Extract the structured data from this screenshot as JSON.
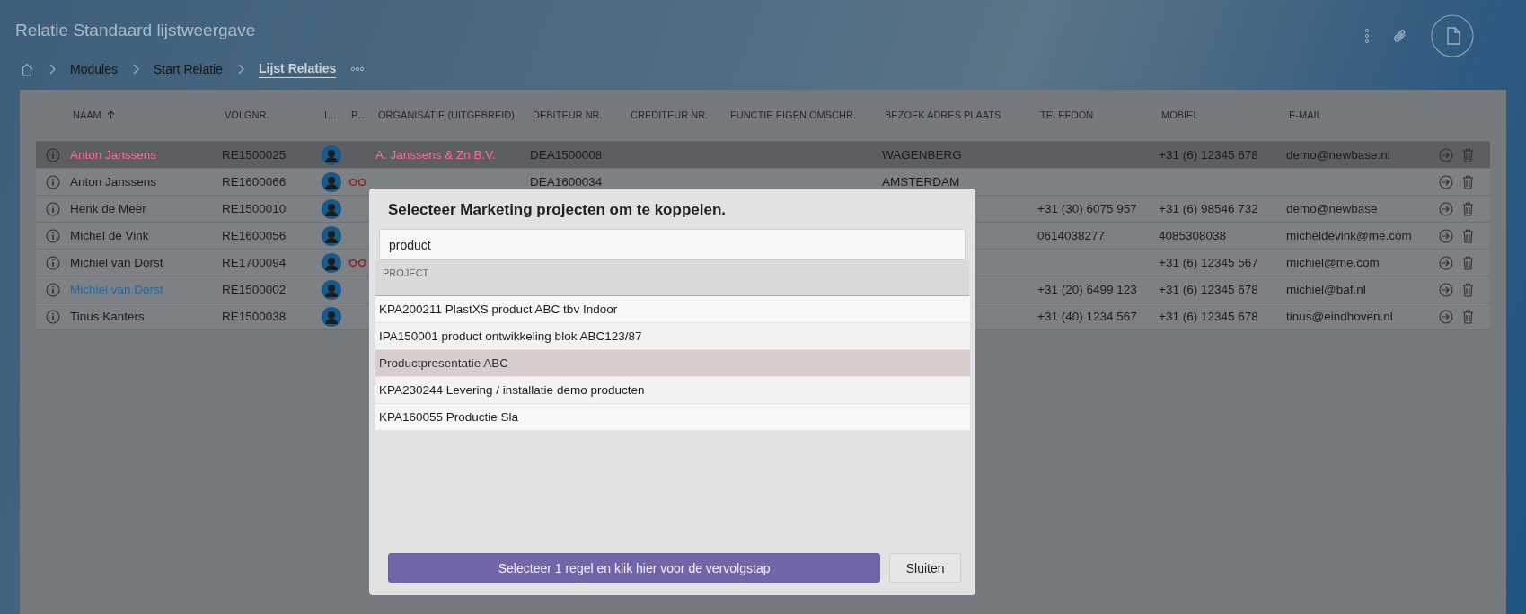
{
  "page": {
    "title": "Relatie Standaard lijstweergave"
  },
  "breadcrumb": [
    {
      "label": "Modules",
      "selected": false
    },
    {
      "label": "Start Relatie",
      "selected": false
    },
    {
      "label": "Lijst Relaties",
      "selected": true
    }
  ],
  "table": {
    "columns": [
      {
        "label": "NAAM",
        "sorted": true
      },
      {
        "label": "VOLGNR."
      },
      {
        "label": "I…"
      },
      {
        "label": "P…"
      },
      {
        "label": "ORGANISATIE (UITGEBREID)"
      },
      {
        "label": "DEBITEUR NR."
      },
      {
        "label": "CREDITEUR NR."
      },
      {
        "label": "FUNCTIE EIGEN OMSCHR."
      },
      {
        "label": "BEZOEK ADRES PLAATS"
      },
      {
        "label": "TELEFOON"
      },
      {
        "label": "MOBIEL"
      },
      {
        "label": "E-MAIL"
      }
    ],
    "rows": [
      {
        "selected": true,
        "color": "#ff6a9a",
        "naam": "Anton Janssens",
        "volgnr": "RE1500025",
        "glasses": false,
        "organisatie": "A. Janssens & Zn B.V.",
        "debiteur": "DEA1500008",
        "plaats": "WAGENBERG",
        "mobiel": "+31 (6) 12345 678",
        "email": "demo@newbase.nl"
      },
      {
        "selected": false,
        "color": "#1c1c1c",
        "naam": "Anton Janssens",
        "volgnr": "RE1600066",
        "glasses": true,
        "debiteur": "DEA1600034",
        "plaats": "AMSTERDAM"
      },
      {
        "selected": false,
        "color": "#1c1c1c",
        "naam": "Henk de Meer",
        "volgnr": "RE1500010",
        "glasses": false,
        "telefoon": "+31 (30) 6075 957",
        "mobiel": "+31 (6) 98546 732",
        "email": "demo@newbase"
      },
      {
        "selected": false,
        "color": "#1c1c1c",
        "naam": "Michel de Vink",
        "volgnr": "RE1600056",
        "glasses": false,
        "telefoon": "0614038277",
        "mobiel": "4085308038",
        "email": "micheldevink@me.com"
      },
      {
        "selected": false,
        "color": "#1c1c1c",
        "naam": "Michiel van Dorst",
        "volgnr": "RE1700094",
        "glasses": true,
        "mobiel": "+31 (6) 12345 567",
        "email": "michiel@me.com"
      },
      {
        "selected": false,
        "color": "#1f6aa5",
        "naam": "Michiel van Dorst",
        "volgnr": "RE1500002",
        "glasses": false,
        "telefoon": "+31 (20) 6499 123",
        "mobiel": "+31 (6) 12345 678",
        "email": "michiel@baf.nl"
      },
      {
        "selected": false,
        "color": "#1c1c1c",
        "naam": "Tinus Kanters",
        "volgnr": "RE1500038",
        "glasses": false,
        "telefoon": "+31 (40) 1234 567",
        "mobiel": "+31 (6) 12345 678",
        "email": "tinus@eindhoven.nl"
      }
    ]
  },
  "modal": {
    "title": "Selecteer Marketing projecten om te koppelen.",
    "search": {
      "value": "product"
    },
    "column": "PROJECT",
    "items": [
      {
        "label": "KPA200211 PlastXS product ABC tbv Indoor",
        "selected": false
      },
      {
        "label": "IPA150001 product ontwikkeling blok ABC123/87",
        "selected": false
      },
      {
        "label": "Productpresentatie ABC",
        "selected": true
      },
      {
        "label": "KPA230244 Levering / installatie demo producten",
        "selected": false
      },
      {
        "label": "KPA160055 Productie Sla",
        "selected": false
      }
    ],
    "primary_button": "Selecteer 1 regel en klik hier voor de vervolgstap",
    "close_button": "Sluiten"
  }
}
